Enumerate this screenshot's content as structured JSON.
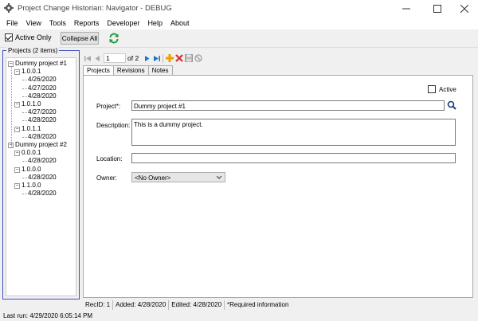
{
  "window": {
    "title": "Project Change Historian:  Navigator - DEBUG",
    "minimize_icon": "minimize-icon",
    "maximize_icon": "maximize-icon",
    "close_icon": "close-icon"
  },
  "menu": [
    "File",
    "View",
    "Tools",
    "Reports",
    "Developer",
    "Help",
    "About"
  ],
  "toolbar": {
    "active_only_label": "Active Only",
    "active_only_checked": true,
    "collapse_label": "Collapse All",
    "refresh_icon": "refresh-icon"
  },
  "sidebar": {
    "title": "Projects (2 items)",
    "tree": [
      {
        "label": "Dummy project #1",
        "level": 0
      },
      {
        "label": "1.0.0.1",
        "level": 1
      },
      {
        "label": "4/26/2020",
        "level": 2
      },
      {
        "label": "4/27/2020",
        "level": 2
      },
      {
        "label": "4/28/2020",
        "level": 2
      },
      {
        "label": "1.0.1.0",
        "level": 1
      },
      {
        "label": "4/27/2020",
        "level": 2
      },
      {
        "label": "4/28/2020",
        "level": 2
      },
      {
        "label": "1.0.1.1",
        "level": 1
      },
      {
        "label": "4/28/2020",
        "level": 2
      },
      {
        "label": "Dummy project #2",
        "level": 0
      },
      {
        "label": "0.0.0.1",
        "level": 1
      },
      {
        "label": "4/28/2020",
        "level": 2
      },
      {
        "label": "1.0.0.0",
        "level": 1
      },
      {
        "label": "4/28/2020",
        "level": 2
      },
      {
        "label": "1.1.0.0",
        "level": 1
      },
      {
        "label": "4/28/2020",
        "level": 2
      }
    ]
  },
  "navigator": {
    "current_page": "1",
    "of_label": "of 2"
  },
  "tabs": [
    "Projects",
    "Revisions",
    "Notes"
  ],
  "form": {
    "active_label": "Active",
    "project_label": "Project*:",
    "project_value": "Dummy project #1",
    "description_label": "Description:",
    "description_value": "This is a dummy project.",
    "location_label": "Location:",
    "location_value": "",
    "owner_label": "Owner:",
    "owner_value": "<No Owner>"
  },
  "status": {
    "recid": "RecID: 1",
    "added": "Added: 4/28/2020",
    "edited": "Edited: 4/28/2020",
    "required": "*Required information"
  },
  "footer": {
    "last_run": "Last run: 4/29/2020 6:05:14 PM"
  },
  "colors": {
    "accent": "#3c4fc4",
    "nav_blue": "#1f6fd1",
    "add_orange": "#e8a000",
    "delete_red": "#d83030"
  }
}
